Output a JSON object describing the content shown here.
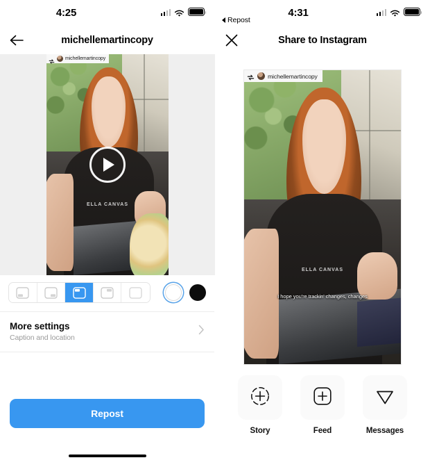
{
  "left": {
    "status": {
      "time": "4:25",
      "signal_icon": "cellular-signal-icon",
      "wifi_icon": "wifi-icon",
      "battery_icon": "battery-icon"
    },
    "nav": {
      "back_icon": "back-arrow-icon",
      "title": "michellemartincopy"
    },
    "media": {
      "attribution": {
        "repost_icon": "repost-icon",
        "avatar": "avatar",
        "username": "michellemartincopy"
      },
      "play_icon": "play-icon",
      "shirt_text": "ELLA CANVAS"
    },
    "position_selector": {
      "options": [
        {
          "name": "attribution-position-bottom-left",
          "icon": "badge-bottom-left-icon",
          "selected": false
        },
        {
          "name": "attribution-position-bottom-right",
          "icon": "badge-bottom-right-icon",
          "selected": false
        },
        {
          "name": "attribution-position-top-left",
          "icon": "badge-top-left-icon",
          "selected": true
        },
        {
          "name": "attribution-position-top-right",
          "icon": "badge-top-right-icon",
          "selected": false
        },
        {
          "name": "attribution-position-none",
          "icon": "badge-none-icon",
          "selected": false
        }
      ],
      "swatches": [
        {
          "name": "color-swatch-white",
          "color": "#FFFFFF",
          "selected": true
        },
        {
          "name": "color-swatch-black",
          "color": "#0C0C0C",
          "selected": false
        }
      ]
    },
    "more_settings": {
      "title": "More settings",
      "subtitle": "Caption and location",
      "chevron_icon": "chevron-right-icon"
    },
    "cta": {
      "label": "Repost"
    }
  },
  "right": {
    "status": {
      "time": "4:31",
      "back_label": "Repost",
      "back_icon": "back-triangle-icon",
      "signal_icon": "cellular-signal-icon",
      "wifi_icon": "wifi-icon",
      "battery_icon": "battery-icon"
    },
    "nav": {
      "close_icon": "close-icon",
      "title": "Share to Instagram"
    },
    "preview": {
      "attribution": {
        "repost_icon": "repost-icon",
        "avatar": "avatar",
        "username": "michellemartincopy"
      },
      "caption": "I hope you're trackin' changes, changes",
      "shirt_text": "ELLA CANVAS"
    },
    "share_options": [
      {
        "name": "share-option-story",
        "icon": "story-add-icon",
        "label": "Story"
      },
      {
        "name": "share-option-feed",
        "icon": "feed-add-icon",
        "label": "Feed"
      },
      {
        "name": "share-option-messages",
        "icon": "paper-plane-icon",
        "label": "Messages"
      }
    ]
  },
  "colors": {
    "accent": "#3897F0",
    "media_bg": "#EFEFEF",
    "card_bg": "#FAFAFA"
  }
}
